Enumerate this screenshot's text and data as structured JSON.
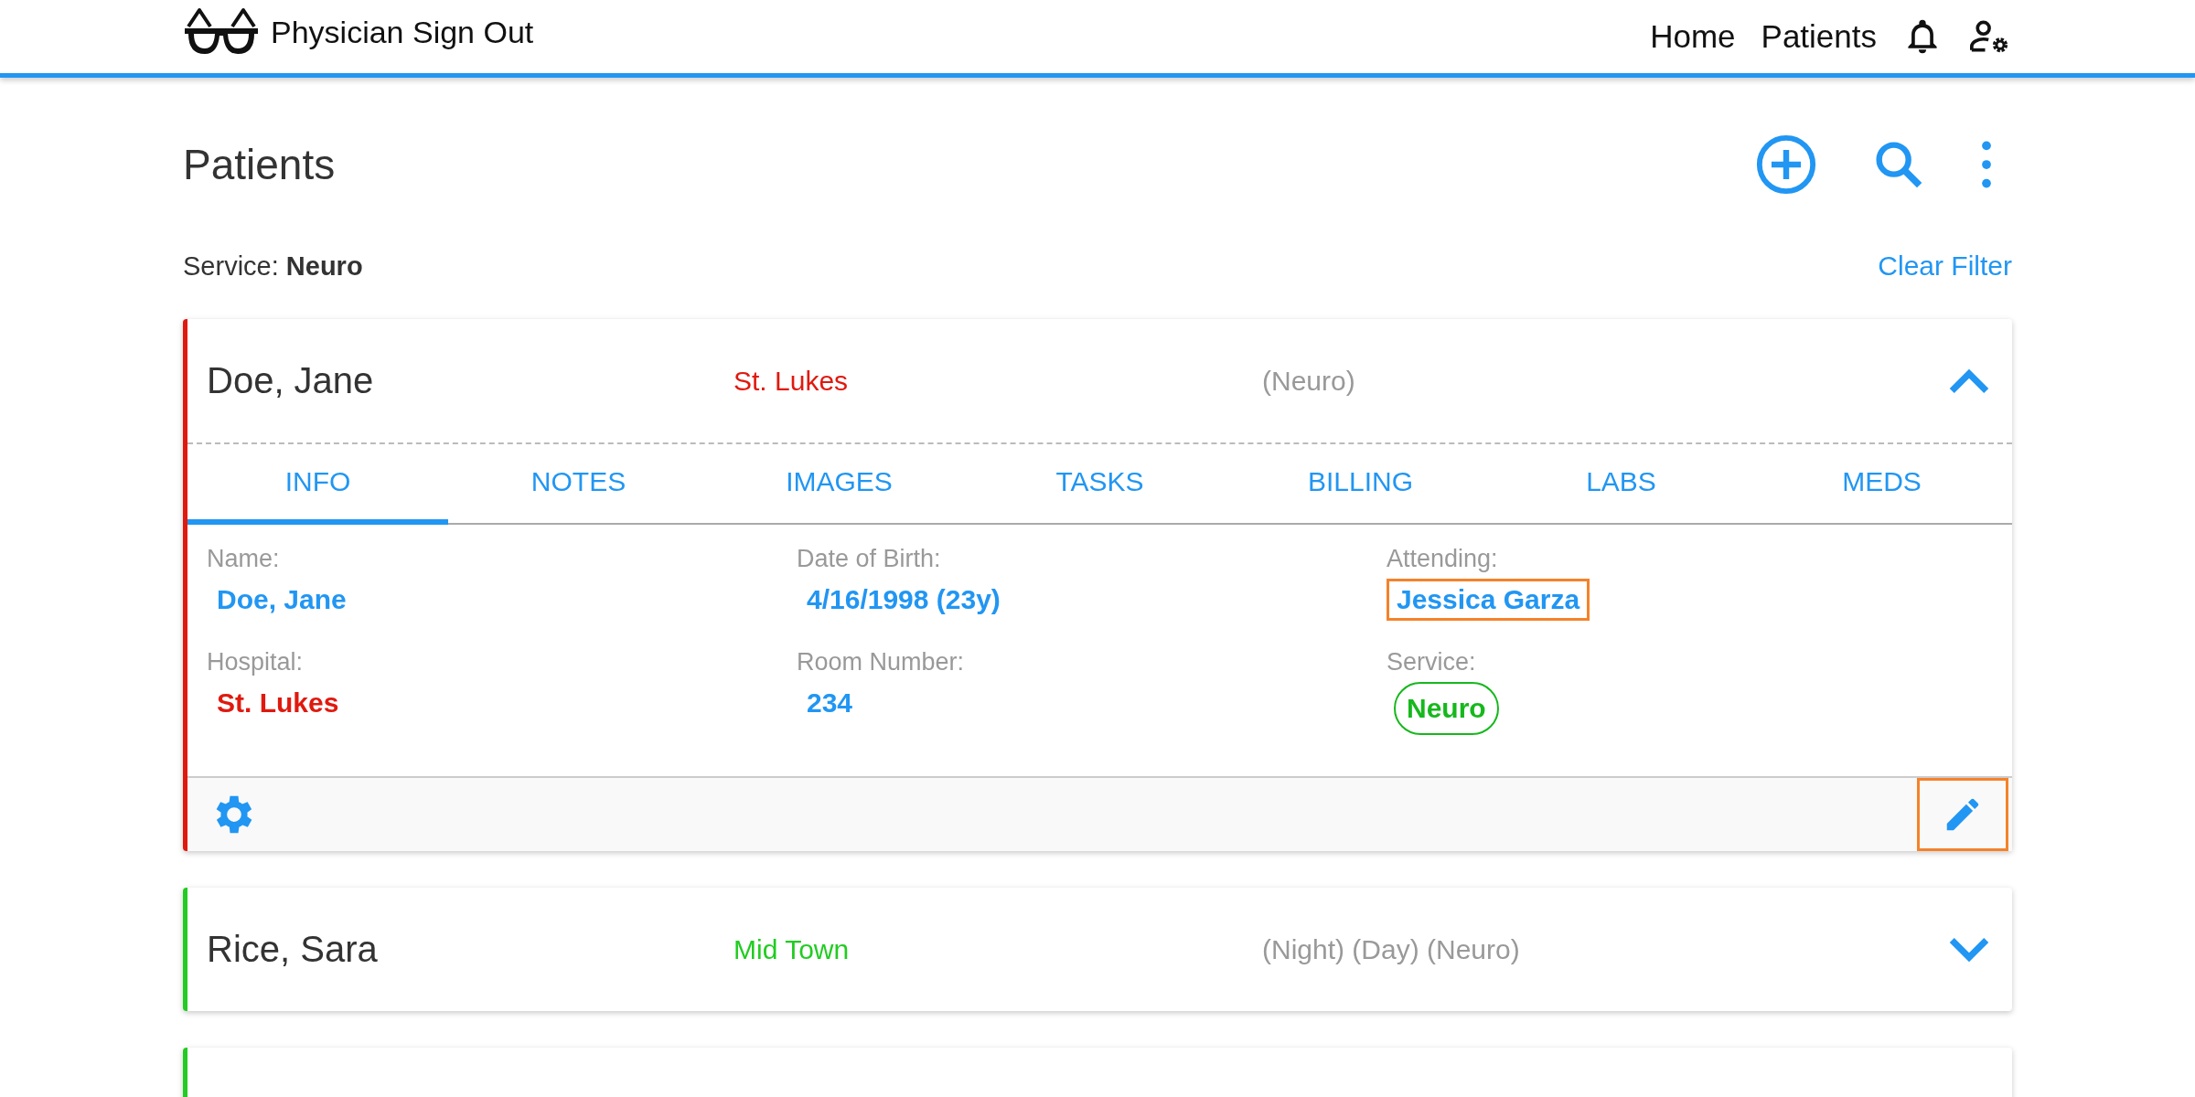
{
  "app": {
    "title": "Physician Sign Out",
    "nav": [
      {
        "label": "Home"
      },
      {
        "label": "Patients"
      }
    ]
  },
  "page": {
    "title": "Patients",
    "filter": {
      "label": "Service:",
      "value": "Neuro",
      "clear": "Clear Filter"
    }
  },
  "cards": [
    {
      "name": "Doe, Jane",
      "hospital": "St. Lukes",
      "services": "(Neuro)",
      "color": "#e0190e",
      "expanded": true,
      "tabs": [
        {
          "label": "INFO",
          "selected": true
        },
        {
          "label": "NOTES",
          "selected": false
        },
        {
          "label": "IMAGES",
          "selected": false
        },
        {
          "label": "TASKS",
          "selected": false
        },
        {
          "label": "BILLING",
          "selected": false
        },
        {
          "label": "LABS",
          "selected": false
        },
        {
          "label": "MEDS",
          "selected": false
        }
      ],
      "fields": [
        {
          "label": "Name:",
          "value": "Doe, Jane",
          "kind": "text",
          "color": "#2196f3",
          "highlighted": false
        },
        {
          "label": "Date of Birth:",
          "value": "4/16/1998 (23y)",
          "kind": "text",
          "color": "#2196f3",
          "highlighted": false
        },
        {
          "label": "Attending:",
          "value": "Jessica Garza",
          "kind": "text",
          "color": "#2196f3",
          "highlighted": true
        },
        {
          "label": "Hospital:",
          "value": "St. Lukes",
          "kind": "text",
          "color": "#e0190e",
          "highlighted": false
        },
        {
          "label": "Room Number:",
          "value": "234",
          "kind": "text",
          "color": "#2196f3",
          "highlighted": false
        },
        {
          "label": "Service:",
          "value": "Neuro",
          "kind": "chip",
          "color": "#16b81c",
          "highlighted": false
        }
      ],
      "edit_highlighted": true
    },
    {
      "name": "Rice, Sara",
      "hospital": "Mid Town",
      "services": "(Night) (Day) (Neuro)",
      "color": "#22cc22",
      "expanded": false
    },
    {
      "color": "#22cc22"
    }
  ]
}
